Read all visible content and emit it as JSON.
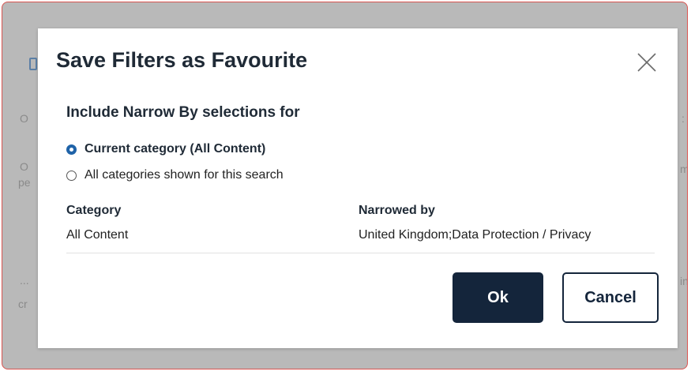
{
  "background": {
    "left_fragments": [
      "O",
      "O",
      "pe",
      "...",
      "cr"
    ],
    "right_fragments": [
      ":",
      "m",
      "in"
    ]
  },
  "dialog": {
    "title": "Save Filters as Favourite",
    "close_icon": "close-icon",
    "section_title": "Include Narrow By selections for",
    "options": [
      {
        "label": "Current category (All Content)",
        "selected": true
      },
      {
        "label": "All categories shown for this search",
        "selected": false
      }
    ],
    "table": {
      "headers": {
        "category": "Category",
        "narrowed_by": "Narrowed by"
      },
      "row": {
        "category": "All Content",
        "narrowed_by": "United Kingdom;Data Protection / Privacy"
      }
    },
    "ok_label": "Ok",
    "cancel_label": "Cancel"
  },
  "colors": {
    "primary": "#14253b",
    "radio_selected": "#1f63a8",
    "frame_border": "#d9534f",
    "overlay": "#b9b9b9"
  }
}
